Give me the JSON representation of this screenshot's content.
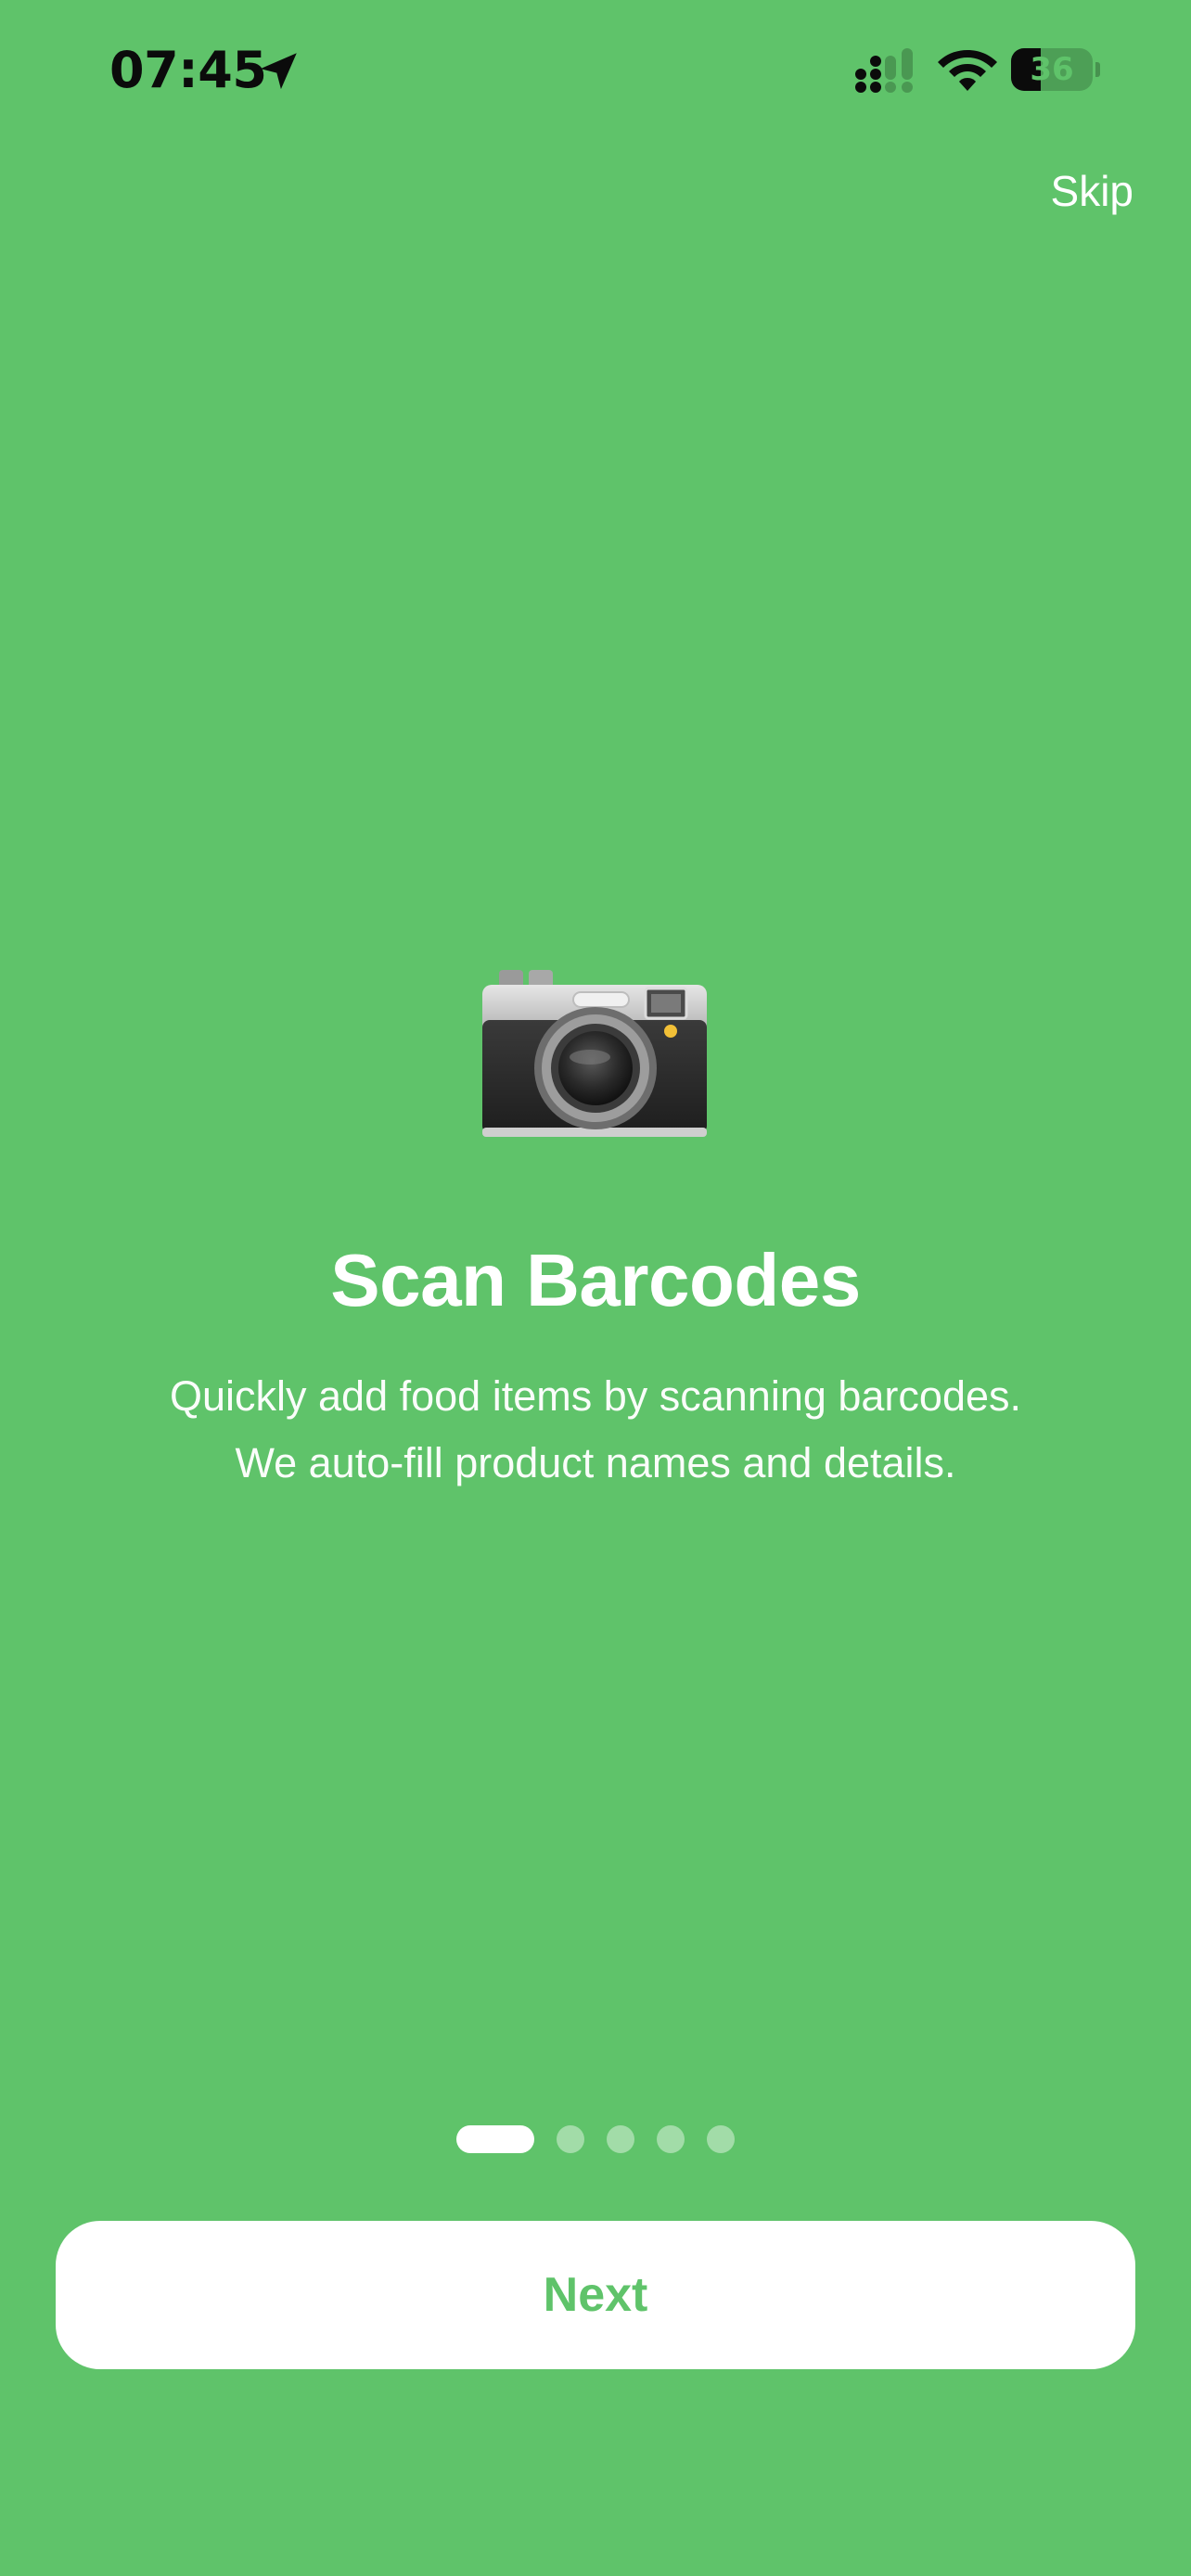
{
  "status_bar": {
    "time": "07:45",
    "battery_level": "36",
    "icons": [
      "location-arrow-icon",
      "cellular-signal-icon",
      "wifi-icon",
      "battery-icon"
    ]
  },
  "header": {
    "skip_label": "Skip"
  },
  "slide": {
    "icon": "camera-icon",
    "title": "Scan Barcodes",
    "description_lines": [
      "Quickly add food items by scanning barcodes.",
      "We auto-fill product names and details."
    ]
  },
  "pagination": {
    "total_pages": 5,
    "current_page": 1
  },
  "footer": {
    "next_label": "Next"
  },
  "colors": {
    "background": "#5fc36a",
    "button_background": "#ffffff",
    "button_text": "#5fc36a",
    "status_text": "#0b0b0b"
  }
}
